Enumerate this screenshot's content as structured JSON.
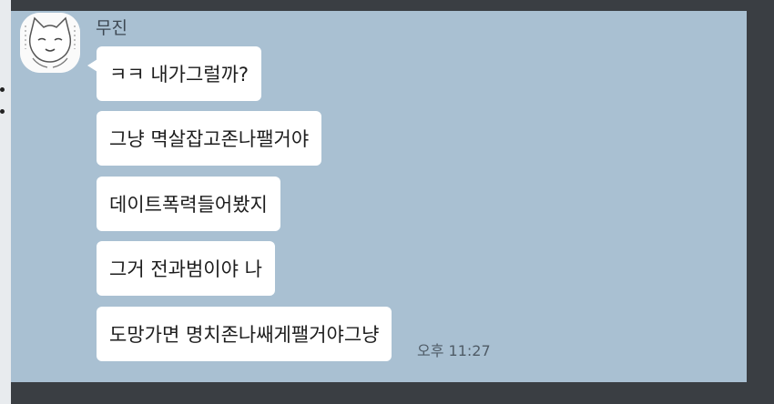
{
  "chat": {
    "sender": "무진",
    "messages": [
      "ㅋㅋ 내가그럴까?",
      "그냥 멱살잡고존나팰거야",
      "데이트폭력들어봤지",
      "그거 전과범이야 나",
      "도망가면 명치존나쌔게팰거야그냥"
    ],
    "timestamp": "오후 11:27"
  },
  "colors": {
    "chat_background": "#a9c0d2",
    "bubble": "#ffffff",
    "frame": "#34383d"
  },
  "icons": {
    "avatar": "cartoon-character-avatar"
  }
}
